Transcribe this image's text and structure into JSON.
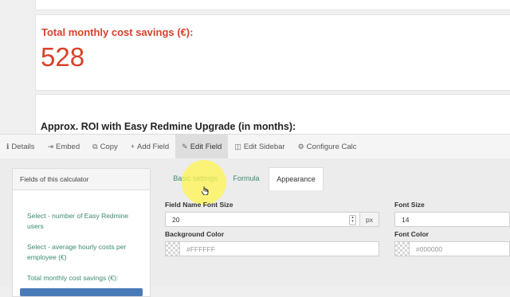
{
  "preview": {
    "savings_label": "Total monthly cost savings (€):",
    "savings_value": "528",
    "roi_label": "Approx. ROI with Easy Redmine Upgrade (in months):"
  },
  "toolbar": {
    "items": [
      {
        "label": "Details",
        "icon": "info-icon"
      },
      {
        "label": "Embed",
        "icon": "embed-icon"
      },
      {
        "label": "Copy",
        "icon": "copy-icon"
      },
      {
        "label": "Add Field",
        "icon": "plus-icon"
      },
      {
        "label": "Edit Field",
        "icon": "pencil-icon",
        "active": true
      },
      {
        "label": "Edit Sidebar",
        "icon": "sidebar-icon"
      },
      {
        "label": "Configure Calc",
        "icon": "gear-icon"
      }
    ]
  },
  "fields_panel": {
    "title": "Fields of this calculator",
    "items": [
      "Select - number of Easy Redmine users",
      "Select - average hourly costs per employee (€)",
      "Total monthly cost savings (€):"
    ]
  },
  "tabs": {
    "basic": "Basic settings",
    "formula": "Formula",
    "appearance": "Appearance"
  },
  "form": {
    "field_name_font_size_label": "Field Name Font Size",
    "field_name_font_size_value": "20",
    "field_name_font_size_unit": "px",
    "font_size_label": "Font Size",
    "font_size_value": "14",
    "background_color_label": "Background Color",
    "background_color_value": "#FFFFFF",
    "font_color_label": "Font Color",
    "font_color_value": "#000000"
  },
  "colors": {
    "accent_red": "#d9412b",
    "link_green": "#3a8a72",
    "selected_blue": "#4a7ab8"
  }
}
